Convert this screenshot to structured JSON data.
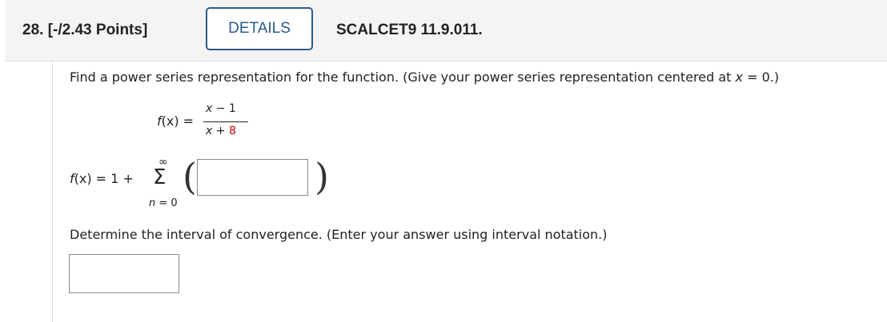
{
  "header": {
    "question_number": "28.",
    "points": "[-/2.43 Points]",
    "details_label": "DETAILS",
    "code": "SCALCET9 11.9.011."
  },
  "question": {
    "prompt_before_var": "Find a power series representation for the function. (Give your power series representation centered at ",
    "prompt_var": "x",
    "prompt_after_var": " = 0.)",
    "function": {
      "lhs_name": "f",
      "lhs_arg": "(x)",
      "equals": " =",
      "numerator_var": "x",
      "numerator_rest": " − 1",
      "denominator_var": "x",
      "denominator_op": " + ",
      "denominator_const": "8"
    },
    "series": {
      "lhs_name": "f",
      "lhs_rest": "(x) = 1 +",
      "upper_limit": "∞",
      "sigma": "Σ",
      "lower_var": "n",
      "lower_rest": " = 0",
      "open_paren": "(",
      "close_paren": ")",
      "term_value": ""
    },
    "interval_prompt": "Determine the interval of convergence. (Enter your answer using interval notation.)",
    "interval_value": ""
  },
  "colors": {
    "accent": "#2c5a8c",
    "highlight": "#cc0000"
  }
}
